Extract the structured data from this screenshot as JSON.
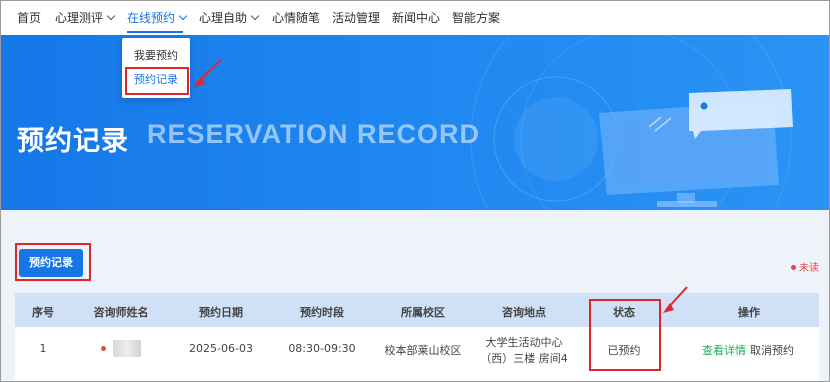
{
  "nav": {
    "items": [
      {
        "label": "首页",
        "has_menu": false
      },
      {
        "label": "心理测评",
        "has_menu": true
      },
      {
        "label": "在线预约",
        "has_menu": true,
        "active": true
      },
      {
        "label": "心理自助",
        "has_menu": true
      },
      {
        "label": "心情随笔",
        "has_menu": false
      },
      {
        "label": "活动管理",
        "has_menu": false
      },
      {
        "label": "新闻中心",
        "has_menu": false
      },
      {
        "label": "智能方案",
        "has_menu": false
      }
    ],
    "dropdown": [
      {
        "label": "我要预约"
      },
      {
        "label": "预约记录",
        "selected": true
      }
    ]
  },
  "banner": {
    "title": "预约记录",
    "subtitle": "RESERVATION RECORD"
  },
  "toolbar": {
    "record_button": "预约记录",
    "unread_label": "未读"
  },
  "table": {
    "columns": [
      "序号",
      "咨询师姓名",
      "预约日期",
      "预约时段",
      "所属校区",
      "咨询地点",
      "状态",
      "操作"
    ],
    "rows": [
      {
        "index": "1",
        "counselor_name": "",
        "date": "2025-06-03",
        "time_slot": "08:30-09:30",
        "campus": "校本部莱山校区",
        "location_line1": "大学生活动中心",
        "location_line2": "（西）三楼 房间4",
        "status": "已预约",
        "action_view": "查看详情",
        "action_cancel": "取消预约"
      }
    ]
  },
  "colors": {
    "primary": "#1676e6",
    "banner": "#1e86f0",
    "annotation_red": "#e0262b",
    "link_green": "#1aaf5d",
    "unread_red": "#e5484d",
    "table_header": "#cfe0f7",
    "page_bg": "#eef2f9"
  }
}
